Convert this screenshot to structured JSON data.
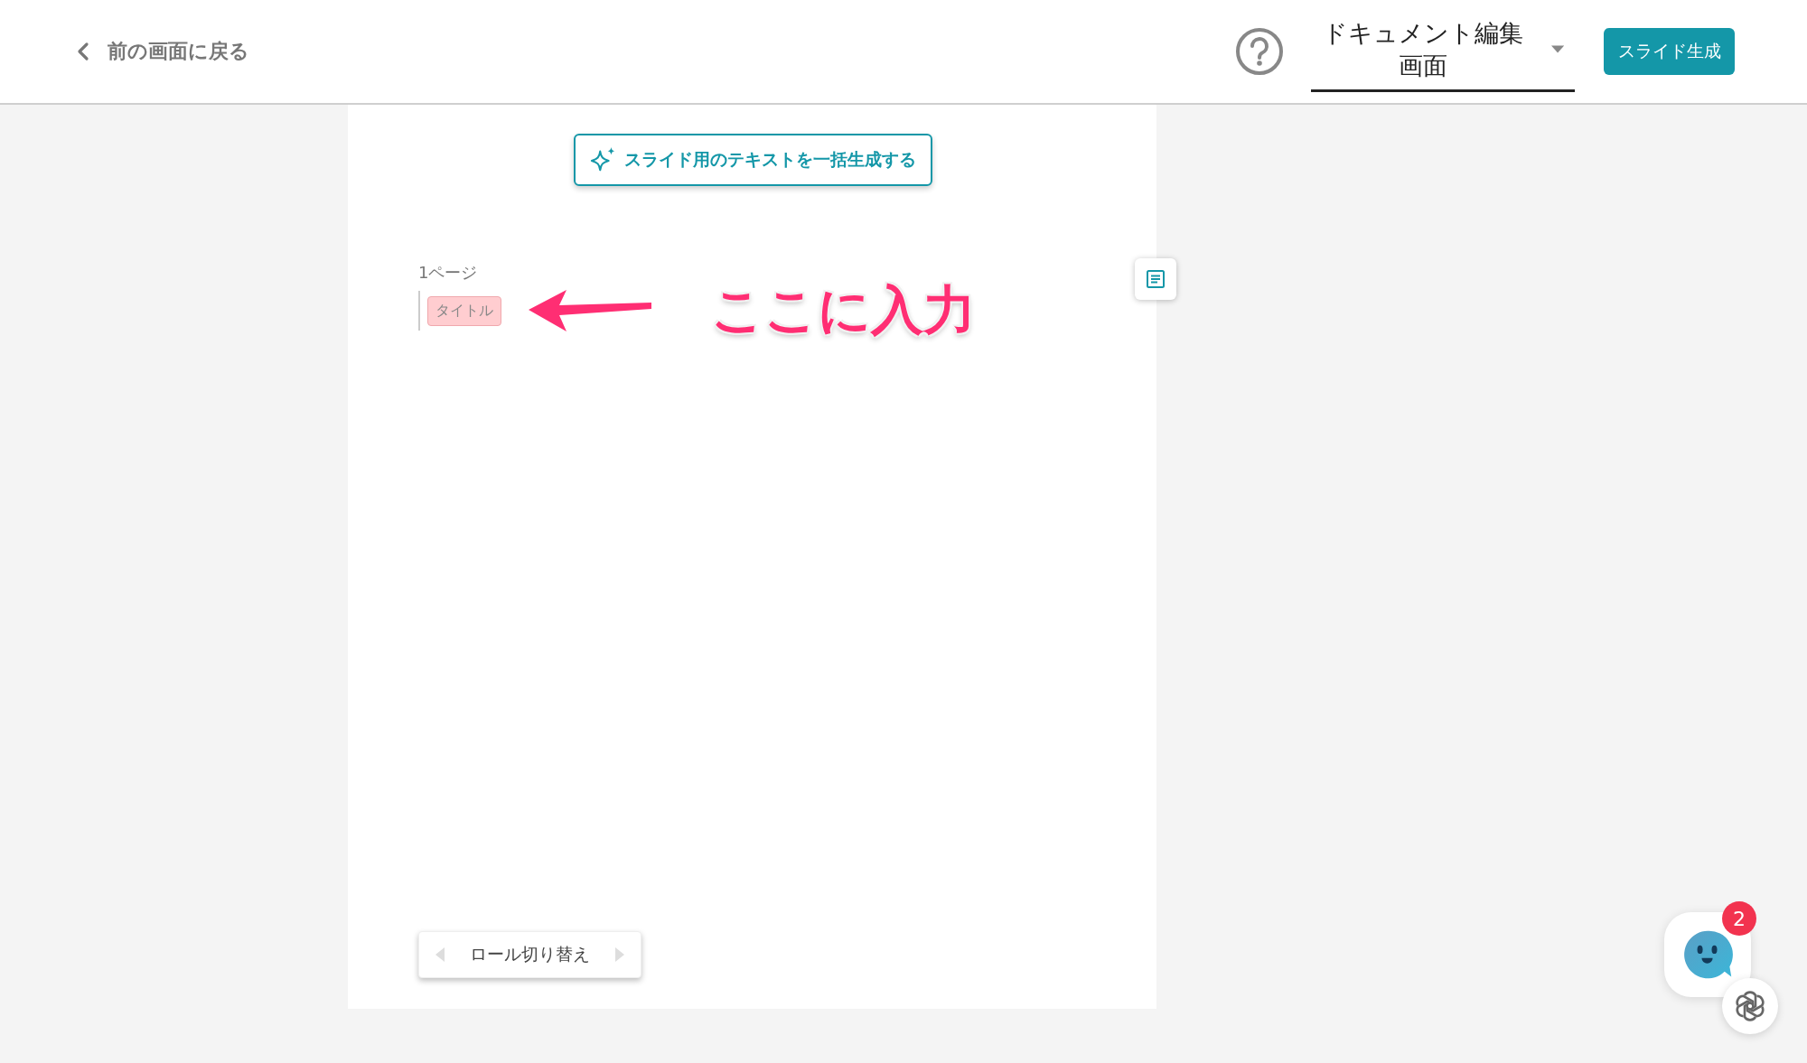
{
  "header": {
    "back_link": "前の画面に戻る",
    "mode_select": {
      "value": "ドキュメント編集画面"
    },
    "generate_button": "スライド生成"
  },
  "document": {
    "bulk_generate_button": "スライド用のテキストを一括生成する",
    "pages": [
      {
        "label": "1ページ",
        "blocks": [
          {
            "kind": "tag",
            "text": "タイトル"
          }
        ]
      }
    ],
    "role_switch": "ロール切り替え"
  },
  "annotation": {
    "text": "ここに入力"
  },
  "chat_widget": {
    "badge": "2"
  }
}
